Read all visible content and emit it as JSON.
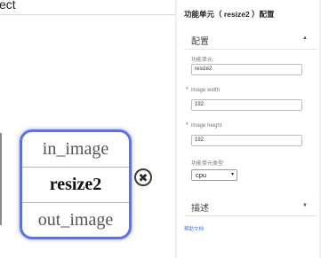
{
  "canvas": {
    "title": "ect",
    "node": {
      "input_port": "in_image",
      "name": "resize2",
      "output_port": "out_image"
    },
    "delete_icon": "✖"
  },
  "panel": {
    "title": "功能单元（ resize2 ）配置",
    "config_section": {
      "label": "配置",
      "arrow": "▲"
    },
    "fields": {
      "unit": {
        "label": "功能单元:",
        "value": "resize2"
      },
      "width": {
        "required_mark": "*",
        "label": "image width",
        "value": "192"
      },
      "height": {
        "required_mark": "*",
        "label": "image height",
        "value": "192"
      },
      "unit_type": {
        "label": "功能单元类型:",
        "selected": "cpu",
        "caret": "▾"
      }
    },
    "desc_section": {
      "label": "描述",
      "arrow": "▼"
    },
    "help_link": "帮助文档"
  },
  "colors": {
    "node_border": "#5a74e8",
    "link": "#3d6fe0",
    "required": "#e03a3a"
  }
}
